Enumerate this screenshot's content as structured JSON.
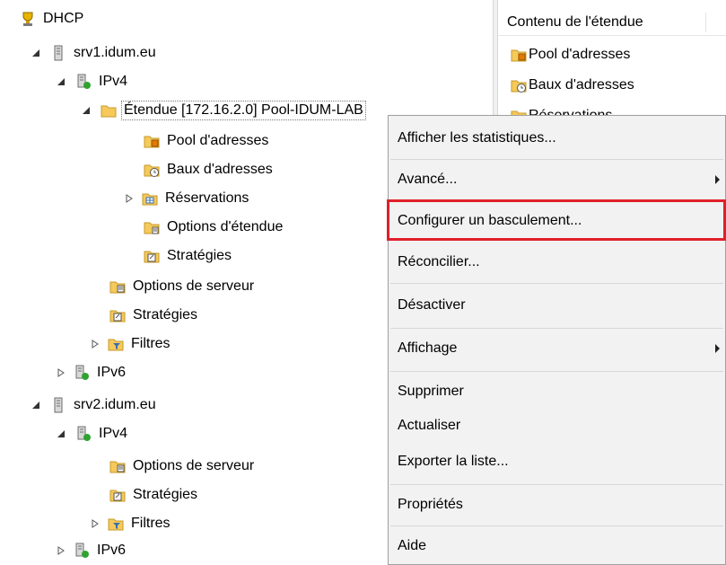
{
  "tree": {
    "root": {
      "label": "DHCP",
      "icon": "dhcp-icon"
    },
    "servers": [
      {
        "label": "srv1.idum.eu",
        "ipv4": {
          "label": "IPv4",
          "scope": {
            "label": "Étendue [172.16.2.0] Pool-IDUM-LAB",
            "children": [
              {
                "label": "Pool d'adresses",
                "icon": "address-pool-icon"
              },
              {
                "label": "Baux d'adresses",
                "icon": "address-leases-icon"
              },
              {
                "label": "Réservations",
                "icon": "reservations-icon"
              },
              {
                "label": "Options d'étendue",
                "icon": "scope-options-icon"
              },
              {
                "label": "Stratégies",
                "icon": "policies-icon"
              }
            ]
          },
          "options": "Options de serveur",
          "policies": "Stratégies",
          "filters": "Filtres"
        },
        "ipv6": "IPv6"
      },
      {
        "label": "srv2.idum.eu",
        "ipv4": {
          "label": "IPv4",
          "options": "Options de serveur",
          "policies": "Stratégies",
          "filters": "Filtres"
        },
        "ipv6": "IPv6"
      }
    ]
  },
  "right_pane": {
    "header": "Contenu de l'étendue",
    "items": [
      "Pool d'adresses",
      "Baux d'adresses",
      "Réservations"
    ]
  },
  "context_menu": {
    "items": [
      {
        "label": "Afficher les statistiques..."
      },
      {
        "label": "Avancé...",
        "submenu": true
      },
      {
        "label": "Configurer un basculement...",
        "highlighted": true
      },
      {
        "label": "Réconcilier..."
      },
      {
        "label": "Désactiver"
      },
      {
        "label": "Affichage",
        "submenu": true
      },
      {
        "label": "Supprimer"
      },
      {
        "label": "Actualiser"
      },
      {
        "label": "Exporter la liste..."
      },
      {
        "label": "Propriétés"
      },
      {
        "label": "Aide"
      }
    ]
  },
  "colors": {
    "selection": "#cce8ff",
    "highlight_border": "#e0202a",
    "menu_bg": "#f2f2f2",
    "folder": "#f5c95a"
  }
}
